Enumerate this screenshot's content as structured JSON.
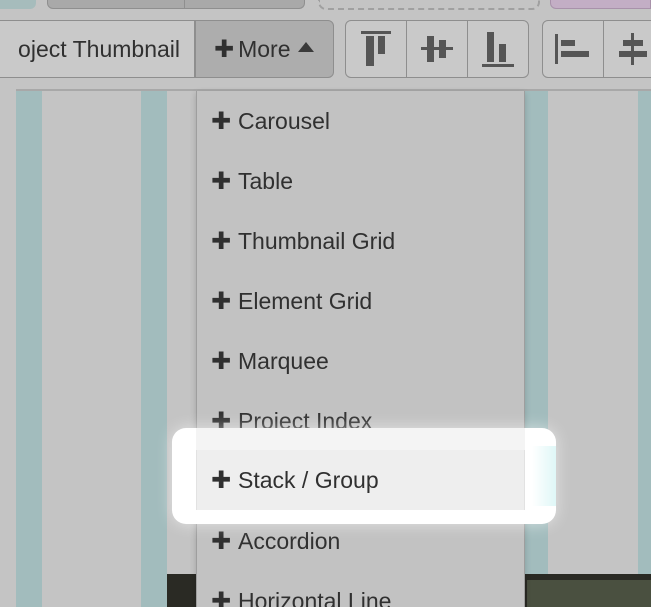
{
  "toolbar": {
    "project_thumbnail_label": "oject Thumbnail",
    "more_label": "More",
    "more_plus": "✚"
  },
  "menu": {
    "plus_glyph": "✚",
    "items": [
      {
        "label": "Carousel"
      },
      {
        "label": "Table"
      },
      {
        "label": "Thumbnail Grid"
      },
      {
        "label": "Element Grid"
      },
      {
        "label": "Marquee"
      },
      {
        "label": "Project Index"
      },
      {
        "label": "Stack / Group"
      },
      {
        "label": "Accordion"
      },
      {
        "label": "Horizontal Line"
      }
    ],
    "highlighted_index": 6
  },
  "icons": {
    "align_top": "align-top-icon",
    "align_middle": "align-middle-icon",
    "align_bottom": "align-bottom-icon",
    "align_left": "align-left-icon",
    "align_center": "align-center-icon"
  },
  "colors": {
    "highlight": "#eeeeee",
    "teal_column": "#a2bcbd",
    "text": "#303030"
  }
}
